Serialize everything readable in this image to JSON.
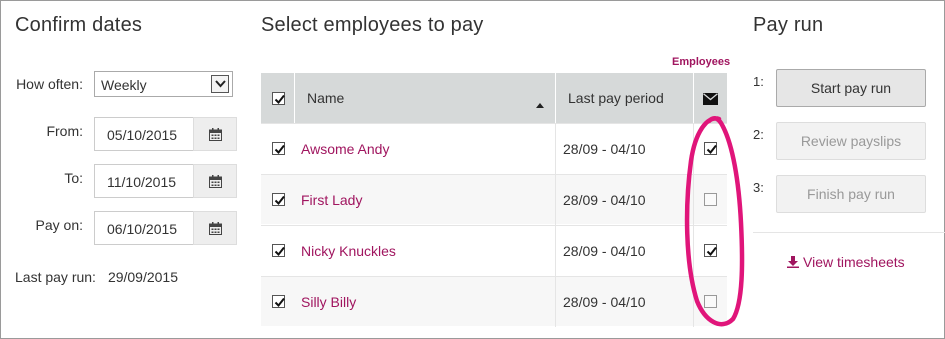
{
  "confirm_dates": {
    "title": "Confirm dates",
    "how_often_label": "How often:",
    "how_often_value": "Weekly",
    "from_label": "From:",
    "from_value": "05/10/2015",
    "to_label": "To:",
    "to_value": "11/10/2015",
    "pay_on_label": "Pay on:",
    "pay_on_value": "06/10/2015",
    "last_pay_run_label": "Last pay run:",
    "last_pay_run_value": "29/09/2015"
  },
  "employees": {
    "title": "Select employees to pay",
    "employees_link": "Employees",
    "columns": {
      "name": "Name",
      "last_pay_period": "Last pay period"
    },
    "header_checked": true,
    "rows": [
      {
        "name": "Awsome Andy",
        "period": "28/09 - 04/10",
        "selected": true,
        "email": true
      },
      {
        "name": "First Lady",
        "period": "28/09 - 04/10",
        "selected": true,
        "email": false
      },
      {
        "name": "Nicky Knuckles",
        "period": "28/09 - 04/10",
        "selected": true,
        "email": true
      },
      {
        "name": "Silly Billy",
        "period": "28/09 - 04/10",
        "selected": true,
        "email": false
      }
    ]
  },
  "pay_run": {
    "title": "Pay run",
    "steps": [
      {
        "num": "1:",
        "label": "Start pay run",
        "enabled": true
      },
      {
        "num": "2:",
        "label": "Review payslips",
        "enabled": false
      },
      {
        "num": "3:",
        "label": "Finish pay run",
        "enabled": false
      }
    ],
    "view_timesheets": "View timesheets"
  },
  "colors": {
    "accent": "#a0155f",
    "annotation": "#e0157a",
    "header_bg": "#d6d9d9"
  },
  "icons": [
    "calendar-icon",
    "envelope-icon",
    "sort-up-icon",
    "download-icon",
    "chevron-down-icon",
    "checkbox-icon"
  ]
}
